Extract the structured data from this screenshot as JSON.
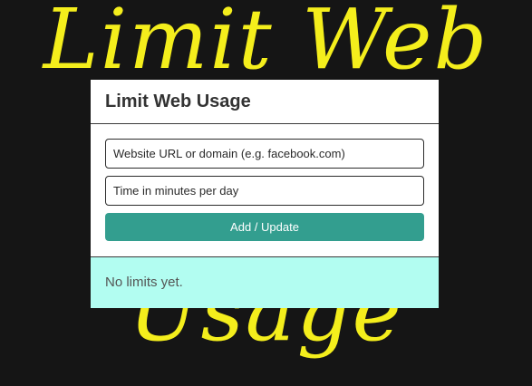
{
  "background": {
    "line1": "Limit Web",
    "line2": "Usage",
    "color": "#f4ee1c"
  },
  "popup": {
    "title": "Limit Web Usage",
    "url_input": {
      "value": "",
      "placeholder": "Website URL or domain (e.g. facebook.com)"
    },
    "minutes_input": {
      "value": "",
      "placeholder": "Time in minutes per day"
    },
    "add_button_label": "Add / Update",
    "empty_message": "No limits yet.",
    "colors": {
      "accent": "#339e8f",
      "limits_background": "#b2fdf1",
      "page_background": "#151515"
    }
  }
}
